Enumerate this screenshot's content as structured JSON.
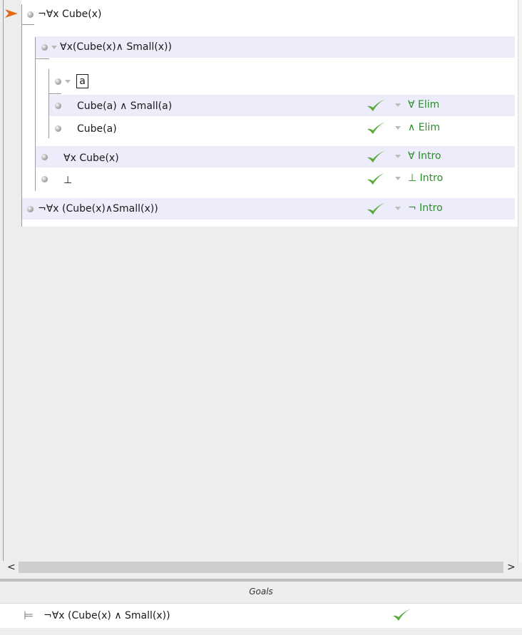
{
  "proof": {
    "premise": "¬∀x Cube(x)",
    "subproof_assumption": "∀x(Cube(x)∧ Small(x))",
    "boxed_constant": "a",
    "steps": [
      {
        "formula": "Cube(a) ∧ Small(a)",
        "rule": "∀ Elim"
      },
      {
        "formula": "Cube(a)",
        "rule": "∧ Elim"
      },
      {
        "formula": "∀x Cube(x)",
        "rule": "∀ Intro"
      },
      {
        "formula": "⊥",
        "rule": "⊥ Intro"
      },
      {
        "formula": "¬∀x (Cube(x)∧Small(x))",
        "rule": "¬ Intro"
      }
    ]
  },
  "scrollbar": {
    "left_arrow": "<",
    "right_arrow": ">"
  },
  "goals": {
    "title": "Goals",
    "items": [
      {
        "symbol": "⊨",
        "formula": "¬∀x (Cube(x) ∧ Small(x))",
        "status": "satisfied"
      }
    ]
  },
  "colors": {
    "band": "#ececfa",
    "rule_text": "#2e8b2e",
    "check": "#5aaa3a",
    "pointer": "#e06a1a"
  },
  "icons": {
    "pointer": "arrow-pointer-icon",
    "check": "check-icon",
    "bullet": "step-bullet-icon",
    "focus": "focus-triangle-icon"
  }
}
